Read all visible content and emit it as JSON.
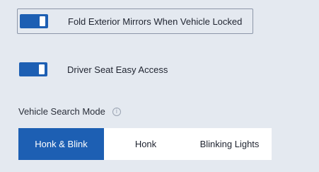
{
  "settings": {
    "fold_mirrors": {
      "label": "Fold Exterior Mirrors When Vehicle Locked",
      "enabled": true
    },
    "driver_seat": {
      "label": "Driver Seat Easy Access",
      "enabled": true
    }
  },
  "vehicle_search": {
    "title": "Vehicle Search Mode",
    "info_icon": "info-icon",
    "options": [
      "Honk & Blink",
      "Honk",
      "Blinking Lights"
    ],
    "selected": "Honk & Blink"
  },
  "colors": {
    "accent": "#1d5fb3",
    "background": "#e4e9f0",
    "segment_bg": "#ffffff"
  }
}
